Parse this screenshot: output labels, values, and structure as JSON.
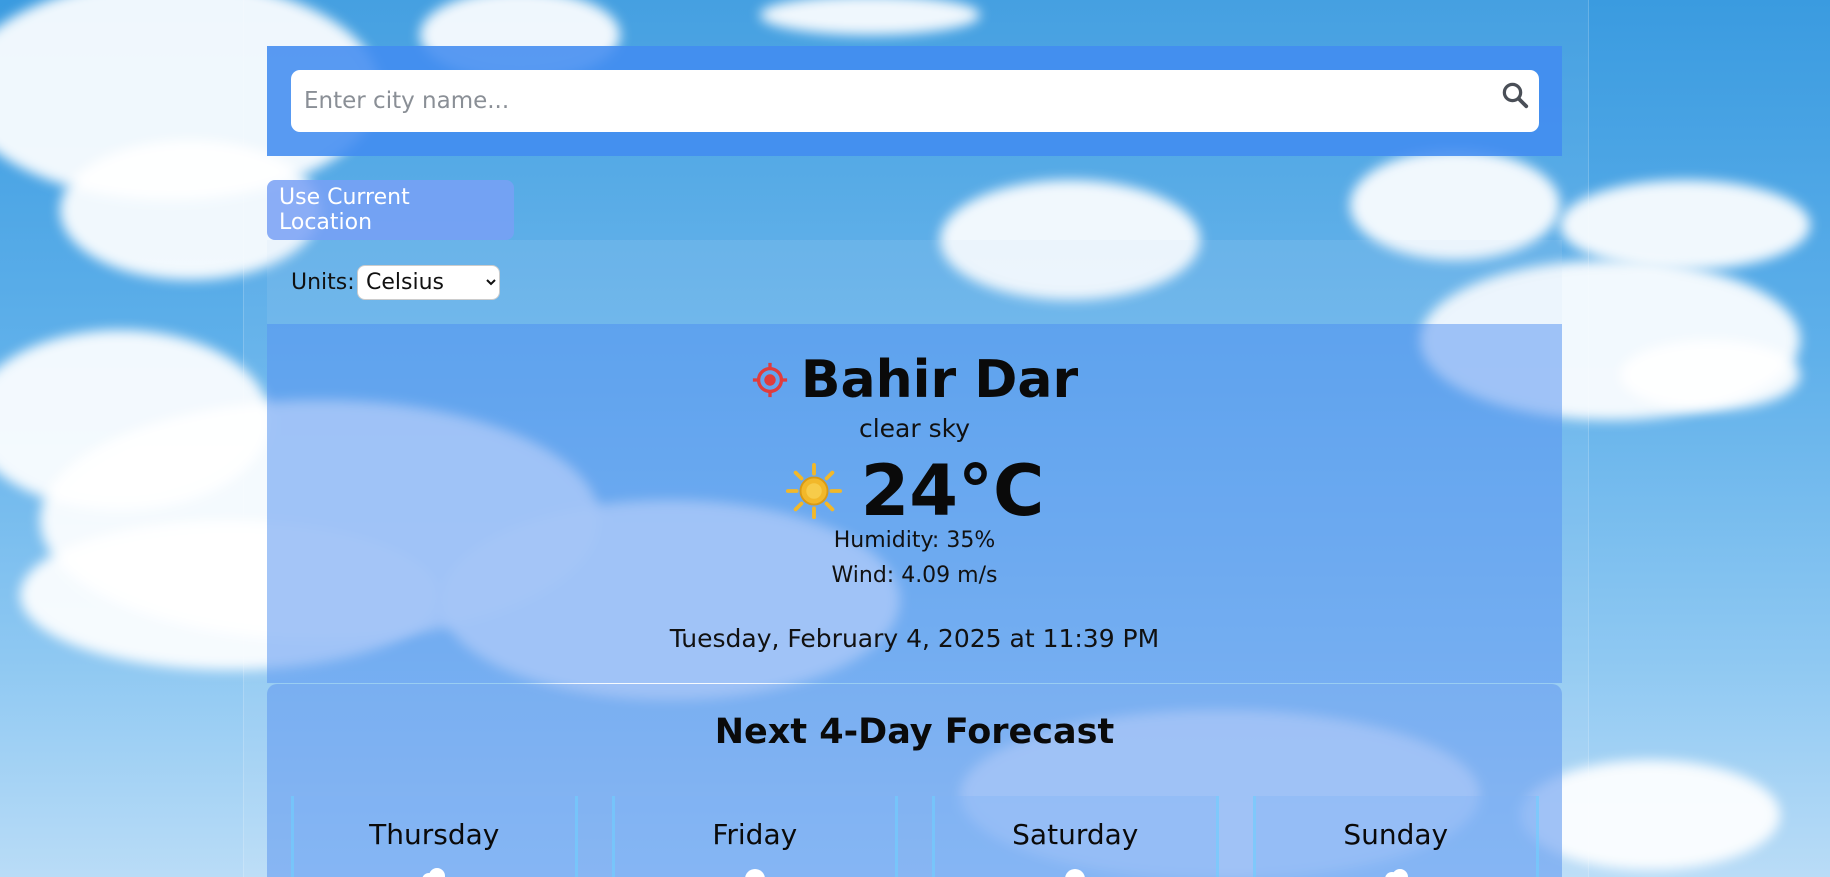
{
  "search": {
    "placeholder": "Enter city name...",
    "icon": "search-icon"
  },
  "location_button": {
    "label": "Use Current Location"
  },
  "units": {
    "label": "Units:",
    "selected": "Celsius"
  },
  "current": {
    "location_icon": "target-icon",
    "city": "Bahir Dar",
    "condition": "clear sky",
    "condition_icon": "sun-icon",
    "temperature": "24°C",
    "humidity": "Humidity: 35%",
    "wind": "Wind: 4.09 m/s",
    "datetime": "Tuesday, February 4, 2025 at 11:39 PM"
  },
  "forecast": {
    "title": "Next 4-Day Forecast",
    "days": [
      {
        "day": "Thursday",
        "icon": "cloud-icon"
      },
      {
        "day": "Friday",
        "icon": "sun-icon"
      },
      {
        "day": "Saturday",
        "icon": "sun-icon"
      },
      {
        "day": "Sunday",
        "icon": "cloud-icon"
      }
    ]
  },
  "colors": {
    "search_bar_bg": "#428cf0",
    "target_icon": "#e03c3c",
    "sun_icon": "#f2b82a"
  }
}
